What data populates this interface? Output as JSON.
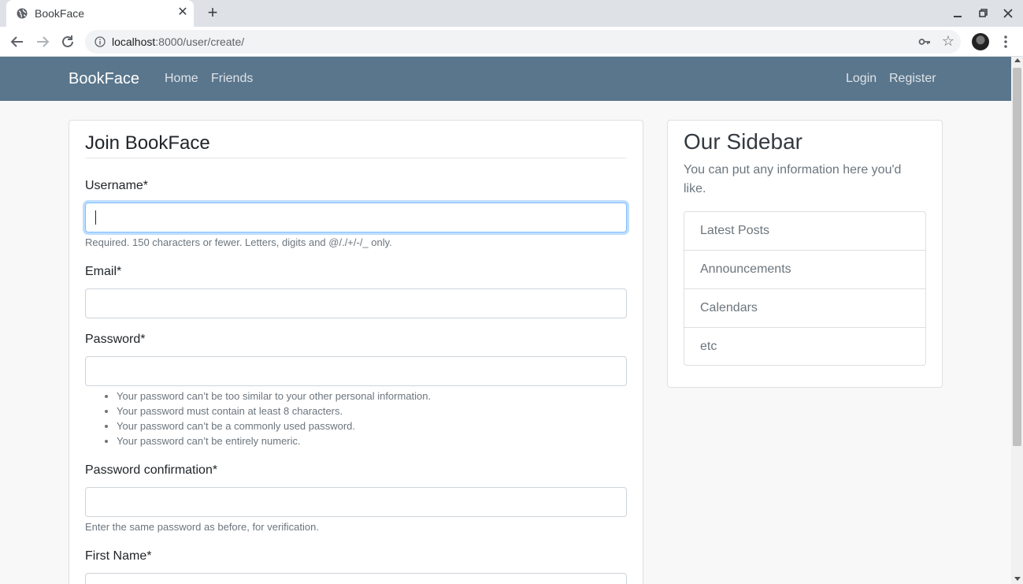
{
  "browser": {
    "tab_title": "BookFace",
    "tab_close": "✕",
    "new_tab": "+",
    "url_host": "localhost",
    "url_rest": ":8000/user/create/",
    "icons": [
      "globe-icon",
      "close-icon",
      "plus-icon",
      "minimize-icon",
      "restore-icon",
      "window-close-icon",
      "back-icon",
      "forward-icon",
      "reload-icon",
      "info-icon",
      "key-icon",
      "star-icon",
      "avatar",
      "menu-icon"
    ]
  },
  "navbar": {
    "brand": "BookFace",
    "links": [
      "Home",
      "Friends"
    ],
    "auth": [
      "Login",
      "Register"
    ],
    "background": "#5a768c"
  },
  "form": {
    "legend": "Join BookFace",
    "username_label": "Username*",
    "username_help": "Required. 150 characters or fewer. Letters, digits and @/./+/-/_ only.",
    "email_label": "Email*",
    "password_label": "Password*",
    "password_help": [
      "Your password can’t be too similar to your other personal information.",
      "Your password must contain at least 8 characters.",
      "Your password can’t be a commonly used password.",
      "Your password can’t be entirely numeric."
    ],
    "password2_label": "Password confirmation*",
    "password2_help": "Enter the same password as before, for verification.",
    "first_name_label": "First Name*",
    "username_value": "",
    "email_value": "",
    "password_value": "",
    "password2_value": "",
    "first_name_value": ""
  },
  "sidebar": {
    "title": "Our Sidebar",
    "text": "You can put any information here you'd like.",
    "items": [
      "Latest Posts",
      "Announcements",
      "Calendars",
      "etc"
    ]
  }
}
